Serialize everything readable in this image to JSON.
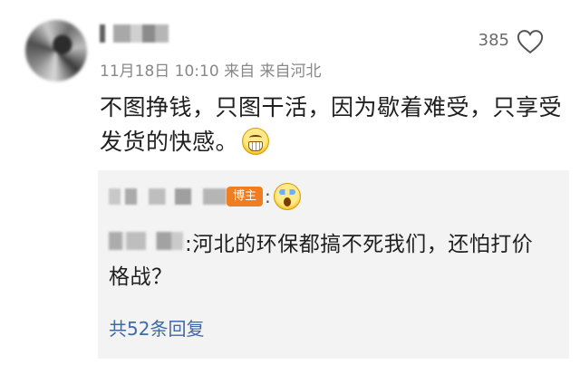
{
  "comment": {
    "likes": "385",
    "date": "11月18日 10:10",
    "source": "来自 来自河北",
    "text": "不图挣钱，只图干活，因为歇着难受，只享受发货的快感。",
    "emoji": "grin-emoji"
  },
  "reply": {
    "badge": "博主",
    "colon": ":",
    "emoji": "shocked-emoji",
    "text": ":河北的环保都搞不死我们，还怕打价格战？",
    "count_label": "共52条回复"
  },
  "icons": {
    "like": "heart-outline-icon"
  },
  "colors": {
    "badge": "#f07d1f",
    "link": "#3f6aa3",
    "panel": "#f3f3f3",
    "meta": "#888888"
  }
}
